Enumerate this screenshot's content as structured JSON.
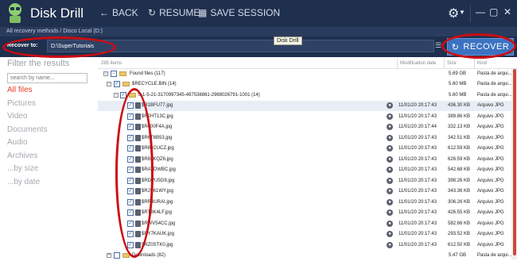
{
  "app": {
    "title": "Disk Drill"
  },
  "toolbar": {
    "back": "BACK",
    "resume": "RESUME",
    "save_session": "SAVE SESSION"
  },
  "breadcrumb": "All recovery methods / Disco Local (D:)",
  "recover": {
    "label": "Recover to:",
    "path": "D:\\SuperTutoriais",
    "button": "RECOVER"
  },
  "tooltip": "Disk Drill",
  "sidebar": {
    "title": "Filter the results",
    "search_placeholder": "search by name...",
    "items": [
      "All files",
      "Pictures",
      "Video",
      "Documents",
      "Audio",
      "Archives",
      "...by size",
      "...by date"
    ]
  },
  "table": {
    "count": "285 items",
    "headers": {
      "modified": "Modification date",
      "size": "Size",
      "kind": "Kind"
    },
    "groups": [
      {
        "name": "Found files (117)",
        "size": "5.69 GB",
        "kind": "Pasta de arqui..."
      },
      {
        "name": "$RECYCLE.BIN (14)",
        "size": "5.60 MB",
        "kind": "Pasta de arqui..."
      },
      {
        "name": "S-1-5-21-3170997345-497538861-2988026791-1001 (14)",
        "size": "5.60 MB",
        "kind": "Pasta de arqui..."
      }
    ],
    "files": [
      {
        "name": "$R1BFU77.jpg",
        "date": "11/01/20 20:17:43",
        "size": "436.30 KB",
        "kind": "Arquivo JPG"
      },
      {
        "name": "$R2HT13C.jpg",
        "date": "11/01/20 20:17:43",
        "size": "389.86 KB",
        "kind": "Arquivo JPG"
      },
      {
        "name": "$R400F4A.jpg",
        "date": "11/01/20 20:17:44",
        "size": "332.13 KB",
        "kind": "Arquivo JPG"
      },
      {
        "name": "$R6T6B53.jpg",
        "date": "11/01/20 20:17:43",
        "size": "342.51 KB",
        "kind": "Arquivo JPG"
      },
      {
        "name": "$R83CUCZ.jpg",
        "date": "11/01/20 20:17:43",
        "size": "612.59 KB",
        "kind": "Arquivo JPG"
      },
      {
        "name": "$R83KQZ6.jpg",
        "date": "11/01/20 20:17:43",
        "size": "626.59 KB",
        "kind": "Arquivo JPG"
      },
      {
        "name": "$RATDWBC.jpg",
        "date": "11/01/20 20:17:43",
        "size": "542.68 KB",
        "kind": "Arquivo JPG"
      },
      {
        "name": "$RDVU5G9.jpg",
        "date": "11/01/20 20:17:43",
        "size": "398.26 KB",
        "kind": "Arquivo JPG"
      },
      {
        "name": "$RJS61WY.jpg",
        "date": "11/01/20 20:17:43",
        "size": "343.36 KB",
        "kind": "Arquivo JPG"
      },
      {
        "name": "$RR3URAI.jpg",
        "date": "11/01/20 20:17:43",
        "size": "306.26 KB",
        "kind": "Arquivo JPG"
      },
      {
        "name": "$RT8K4LF.jpg",
        "date": "11/01/20 20:17:43",
        "size": "426.55 KB",
        "kind": "Arquivo JPG"
      },
      {
        "name": "$RWV54CC.jpg",
        "date": "11/01/20 20:17:43",
        "size": "582.66 KB",
        "kind": "Arquivo JPG"
      },
      {
        "name": "$RY7KAUK.jpg",
        "date": "11/01/20 20:17:43",
        "size": "293.52 KB",
        "kind": "Arquivo JPG"
      },
      {
        "name": "$RZ0STK0.jpg",
        "date": "11/01/20 20:17:43",
        "size": "612.50 KB",
        "kind": "Arquivo JPG"
      }
    ],
    "footer_group": {
      "name": "Downloads (82)",
      "size": "5.47 GB",
      "kind": "Pasta de arqui..."
    }
  },
  "colors": {
    "topbar": "#1f2f4e",
    "accent": "#3b73c2",
    "active_filter": "#e8402a",
    "annotation": "#cc0c12"
  },
  "icons": {
    "back": "back-arrow-icon",
    "resume": "resume-icon",
    "save": "save-icon",
    "settings": "gear-icon",
    "recover": "recover-icon"
  }
}
